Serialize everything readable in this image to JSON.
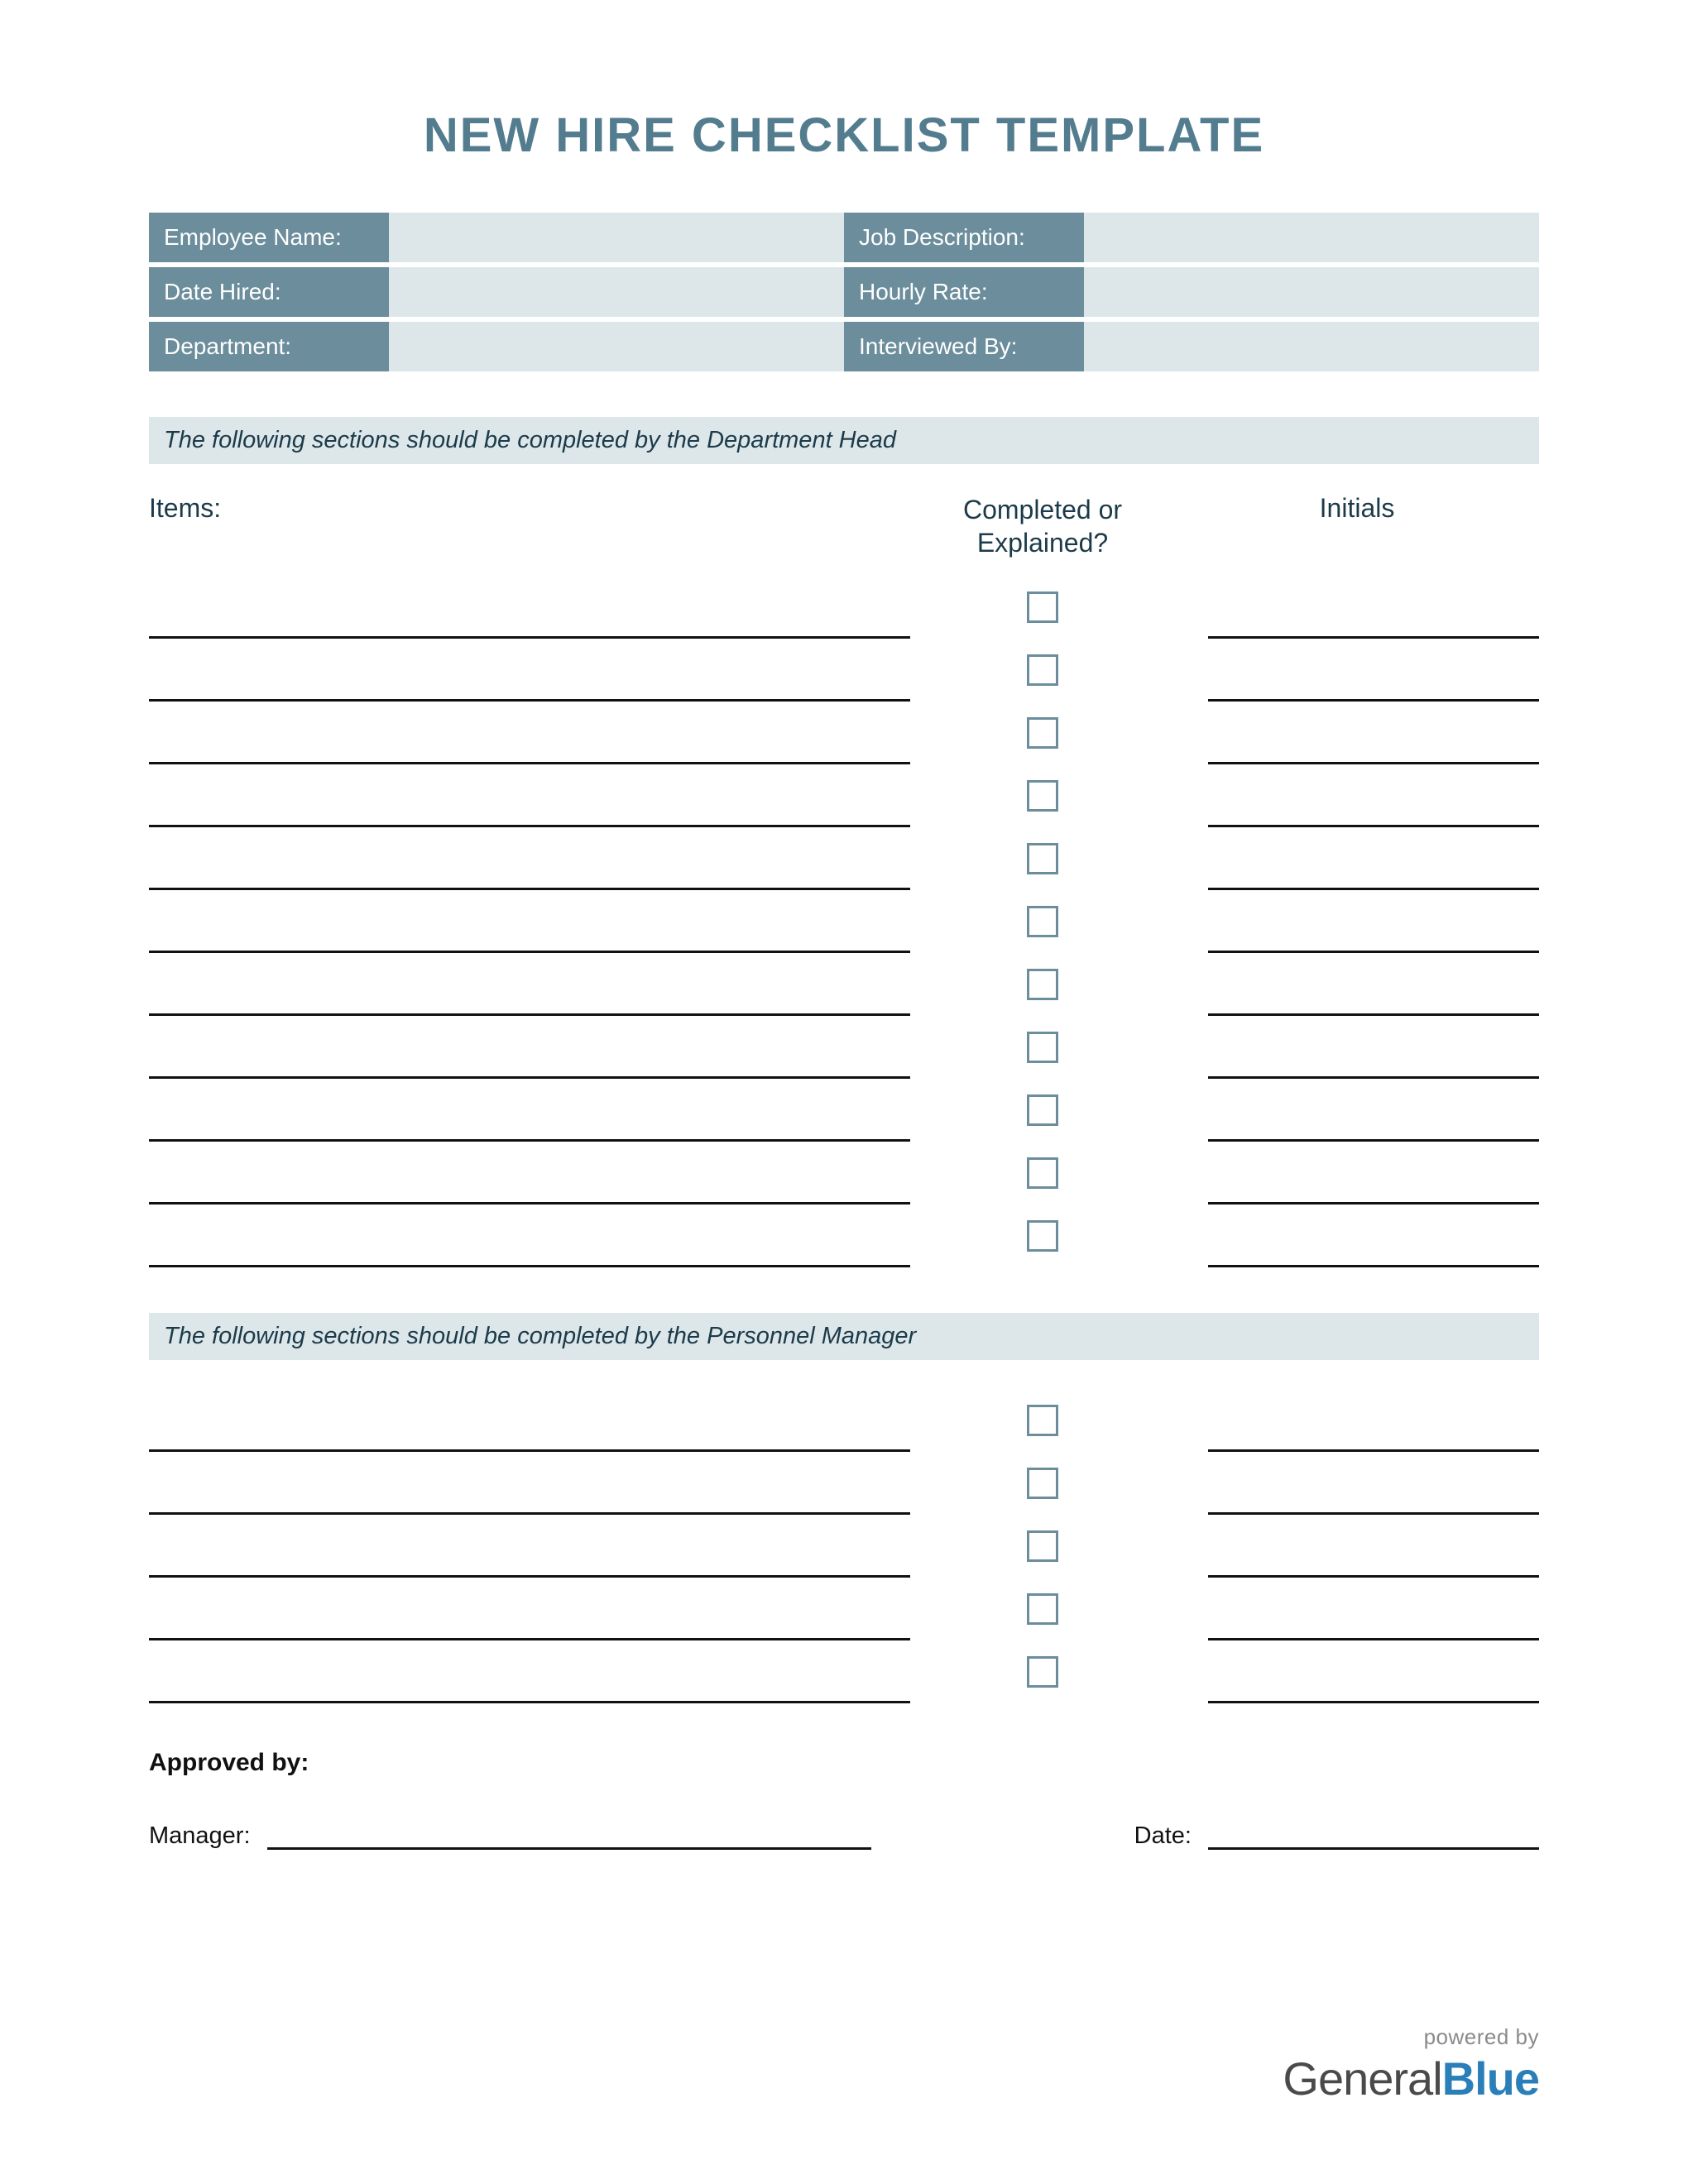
{
  "title": "NEW HIRE CHECKLIST TEMPLATE",
  "header": {
    "employee_name": "Employee Name:",
    "job_description": "Job Description:",
    "date_hired": "Date Hired:",
    "hourly_rate": "Hourly Rate:",
    "department": "Department:",
    "interviewed_by": "Interviewed By:"
  },
  "section1_banner": "The following sections should be completed by the Department Head",
  "columns": {
    "items": "Items:",
    "completed": "Completed or Explained?",
    "initials": "Initials"
  },
  "section1_row_count": 11,
  "section2_banner": "The following sections should be completed by the Personnel Manager",
  "section2_row_count": 5,
  "approval": {
    "approved_by": "Approved by:",
    "manager": "Manager:",
    "date": "Date:"
  },
  "footer": {
    "powered": "powered by",
    "brand_a": "General",
    "brand_b": "Blue"
  }
}
